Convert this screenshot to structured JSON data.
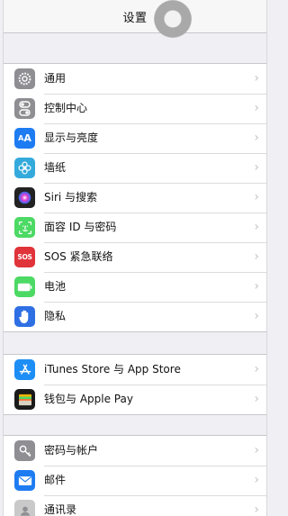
{
  "nav": {
    "title": "设置"
  },
  "groups": [
    {
      "items": [
        {
          "label": "通用",
          "icon": "gear-icon",
          "color": "#8e8e93"
        },
        {
          "label": "控制中心",
          "icon": "toggles-icon",
          "color": "#8e8e93"
        },
        {
          "label": "显示与亮度",
          "icon": "text-size-icon",
          "color": "#1e7cf2"
        },
        {
          "label": "墙纸",
          "icon": "flower-icon",
          "color": "#34aadc"
        },
        {
          "label": "Siri 与搜索",
          "icon": "siri-icon",
          "color": "#222222"
        },
        {
          "label": "面容 ID 与密码",
          "icon": "face-id-icon",
          "color": "#4cd964"
        },
        {
          "label": "SOS 紧急联络",
          "icon": "sos-icon",
          "color": "#e0333a",
          "icon_text": "SOS"
        },
        {
          "label": "电池",
          "icon": "battery-icon",
          "color": "#4cd964"
        },
        {
          "label": "隐私",
          "icon": "hand-icon",
          "color": "#2f6fe4"
        }
      ]
    },
    {
      "items": [
        {
          "label": "iTunes Store 与 App Store",
          "icon": "app-store-icon",
          "color": "#1d8ef5"
        },
        {
          "label": "钱包与 Apple Pay",
          "icon": "wallet-icon",
          "color": "#1a1a1a"
        }
      ]
    },
    {
      "items": [
        {
          "label": "密码与帐户",
          "icon": "key-icon",
          "color": "#8e8e93"
        },
        {
          "label": "邮件",
          "icon": "mail-icon",
          "color": "#1e7cf2"
        },
        {
          "label": "通讯录",
          "icon": "contacts-icon",
          "color": "#b9b9b9"
        }
      ]
    }
  ]
}
